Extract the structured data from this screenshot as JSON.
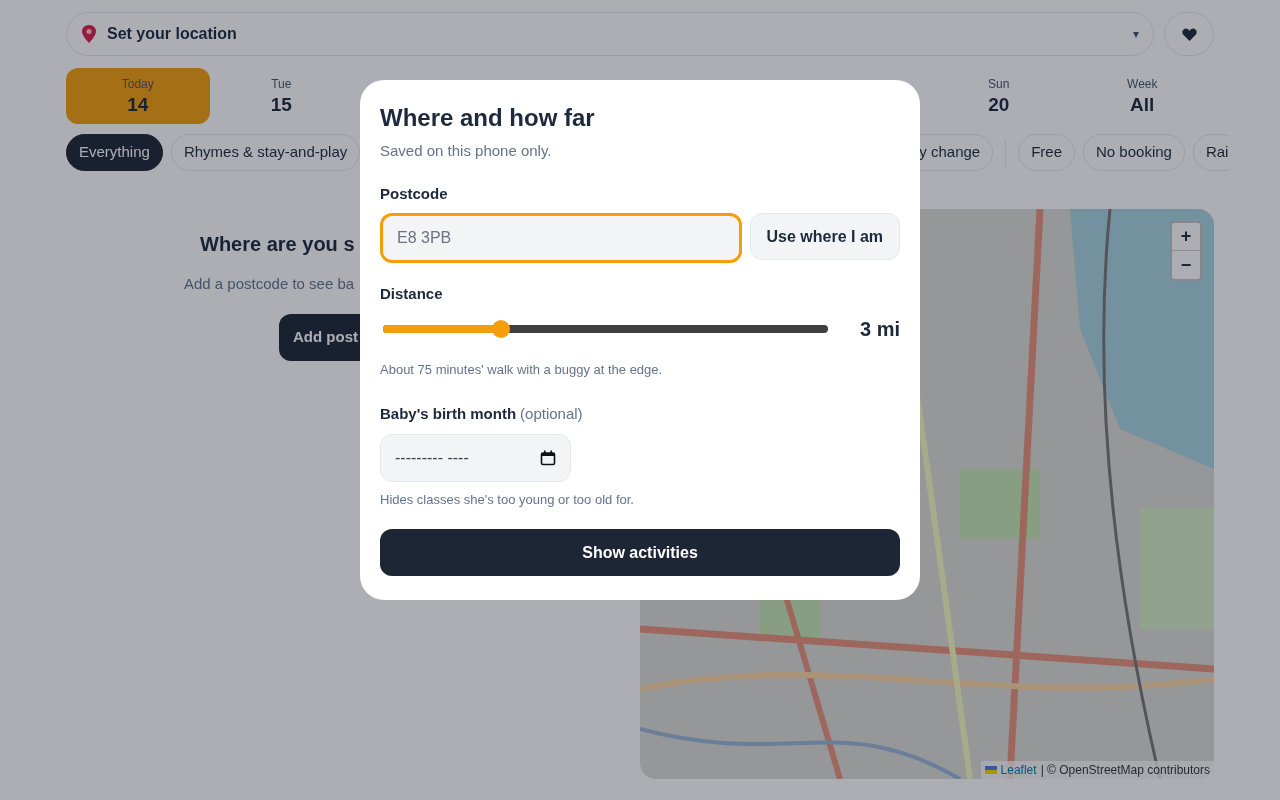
{
  "location_bar": {
    "label": "Set your location",
    "caret": "▾"
  },
  "days": [
    {
      "weekday": "Today",
      "date": "14",
      "selected": true
    },
    {
      "weekday": "Tue",
      "date": "15",
      "selected": false
    },
    {
      "weekday": "Sun",
      "date": "20",
      "selected": false
    },
    {
      "weekday": "Week",
      "date": "All",
      "selected": false
    }
  ],
  "filters_left": [
    {
      "label": "Everything",
      "selected": true
    },
    {
      "label": "Rhymes & stay-and-play",
      "selected": false
    }
  ],
  "filters_right": [
    {
      "label": "y change",
      "selected": false
    },
    {
      "label": "Free",
      "selected": false
    },
    {
      "label": "No booking",
      "selected": false
    },
    {
      "label": "Rai",
      "selected": false
    }
  ],
  "empty_state": {
    "title": "Where are you s",
    "text": "Add a postcode to see ba",
    "button": "Add post"
  },
  "map": {
    "zoom_in": "+",
    "zoom_out": "−",
    "attribution_link": "Leaflet",
    "attribution_text": "| © OpenStreetMap contributors"
  },
  "dialog": {
    "title": "Where and how far",
    "subtitle": "Saved on this phone only.",
    "postcode": {
      "label": "Postcode",
      "placeholder": "E8 3PB",
      "focused": true
    },
    "locate_button": "Use where I am",
    "distance": {
      "label": "Distance",
      "level": 0.27,
      "reading": "3 mi",
      "hint": "About 75 minutes' walk with a buggy at the edge."
    },
    "birth_month": {
      "label": "Baby's birth month",
      "optional": "(optional)",
      "placeholder": "--------- ----",
      "hint": "Hides classes she's too young or too old for."
    },
    "submit": "Show activities"
  }
}
